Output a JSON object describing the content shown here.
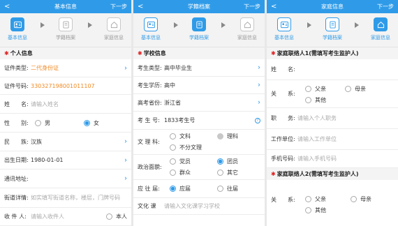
{
  "s1": {
    "header": {
      "back": "<",
      "title": "基本信息",
      "next": "下一步"
    },
    "steps": [
      "基本信息",
      "学籍档案",
      "家庭信息"
    ],
    "section": "个人信息",
    "rows": {
      "id_type": {
        "label": "证件类型:",
        "value": "二代身份证"
      },
      "id_no": {
        "label": "证件号码:",
        "value": "330327198001011107"
      },
      "name": {
        "label": "姓　　名:",
        "placeholder": "请输入姓名"
      },
      "gender": {
        "label": "性　　别:",
        "opt1": "男",
        "opt2": "女"
      },
      "ethnic": {
        "label": "民　　族:",
        "value": "汉族"
      },
      "birth": {
        "label": "出生日期:",
        "value": "1980-01-01"
      },
      "address": {
        "label": "通讯地址:"
      },
      "street": {
        "label": "街道详情:",
        "placeholder": "如实填写街道名称，楼层，门牌号码"
      },
      "receiver": {
        "label": "收 件 人:",
        "placeholder": "请输入收件人",
        "self": "本人"
      }
    }
  },
  "s2": {
    "header": {
      "back": "<",
      "title": "学籍档案",
      "next": "下一步"
    },
    "steps": [
      "基本信息",
      "学籍档案",
      "家庭信息"
    ],
    "section": "学校信息",
    "rows": {
      "type": {
        "label": "考生类型:",
        "value": "高中毕业生"
      },
      "edu": {
        "label": "考生学历:",
        "value": "高中"
      },
      "province": {
        "label": "高考省份:",
        "value": "浙江省"
      },
      "exam_no": {
        "label": "考 生 号:",
        "value": "1833考生号",
        "help": "?"
      },
      "subject": {
        "label": "文 理 科:",
        "o1": "文科",
        "o2": "理科",
        "o3": "不分文理"
      },
      "politics": {
        "label": "政治面貌:",
        "o1": "党员",
        "o2": "团员",
        "o3": "群众",
        "o4": "其它"
      },
      "grad": {
        "label": "应 往 届:",
        "o1": "应届",
        "o2": "往届"
      },
      "score": {
        "label": "文化 课",
        "placeholder": "请输入文化课学习学校"
      }
    }
  },
  "s3": {
    "header": {
      "back": "<",
      "title": "家庭信息",
      "next": "下一步"
    },
    "steps": [
      "基本信息",
      "学籍档案",
      "家庭信息"
    ],
    "section1": "家庭联络人1(需填写考生监护人)",
    "section2": "家庭联络人2(需填写考生监护人)",
    "rows": {
      "name": {
        "label": "姓　　名:"
      },
      "rel": {
        "label": "关　　系:",
        "o1": "父亲",
        "o2": "母亲",
        "o3": "其他"
      },
      "job": {
        "label": "职　　务:",
        "placeholder": "请输入个人职务"
      },
      "work": {
        "label": "工作单位:",
        "placeholder": "请输入工作单位"
      },
      "phone": {
        "label": "手机号码:",
        "placeholder": "请输入手机号码"
      },
      "rel2": {
        "label": "关　　系:",
        "o1": "父亲",
        "o2": "母亲",
        "o3": "其他"
      }
    }
  },
  "colors": {
    "accent": "#2f9be8",
    "star": "#e02020",
    "orange": "#f08a24"
  }
}
